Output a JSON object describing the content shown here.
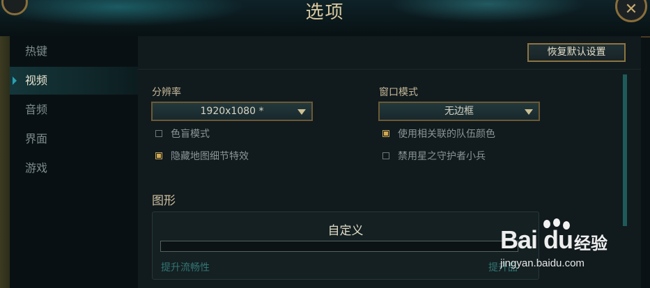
{
  "window": {
    "title": "选项",
    "close_icon": "close-icon"
  },
  "sidebar": {
    "items": [
      {
        "label": "热键",
        "active": false
      },
      {
        "label": "视频",
        "active": true
      },
      {
        "label": "音频",
        "active": false
      },
      {
        "label": "界面",
        "active": false
      },
      {
        "label": "游戏",
        "active": false
      }
    ]
  },
  "toolbar": {
    "restore_defaults_label": "恢复默认设置"
  },
  "video": {
    "resolution": {
      "label": "分辨率",
      "value": "1920x1080 *"
    },
    "window_mode": {
      "label": "窗口模式",
      "value": "无边框"
    },
    "options": [
      {
        "label": "色盲模式",
        "checked": false
      },
      {
        "label": "使用相关联的队伍颜色",
        "checked": true
      },
      {
        "label": "隐藏地图细节特效",
        "checked": true
      },
      {
        "label": "禁用星之守护者小兵",
        "checked": false
      }
    ]
  },
  "graphics": {
    "section_title": "图形",
    "preset": "自定义",
    "min_label": "提升流畅性",
    "max_label": "提升品"
  },
  "watermark": {
    "brand": "Bai du",
    "suffix": "经验",
    "url": "jingyan.baidu.com"
  },
  "colors": {
    "accent_gold": "#c8aa6e",
    "accent_teal": "#2aa0b0",
    "panel_bg": "#111a1d"
  }
}
